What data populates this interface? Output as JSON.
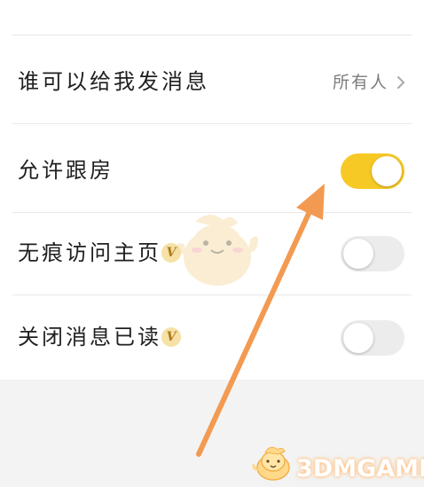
{
  "settings": {
    "rows": [
      {
        "label": "谁可以给我发消息",
        "value": "所有人",
        "type": "link"
      },
      {
        "label": "允许跟房",
        "type": "toggle",
        "enabled": true
      },
      {
        "label": "无痕访问主页",
        "vip_badge": "V",
        "type": "toggle",
        "enabled": false
      },
      {
        "label": "关闭消息已读",
        "vip_badge": "V",
        "type": "toggle",
        "enabled": false
      }
    ]
  },
  "colors": {
    "toggle_on": "#f7c925",
    "toggle_off": "#ececec",
    "arrow": "#f39a52",
    "vip_badge_bg": "#f6e1a6"
  },
  "watermark": {
    "logo_text": "3DMGAME",
    "mascot_icon": "chick-mascot-icon"
  }
}
